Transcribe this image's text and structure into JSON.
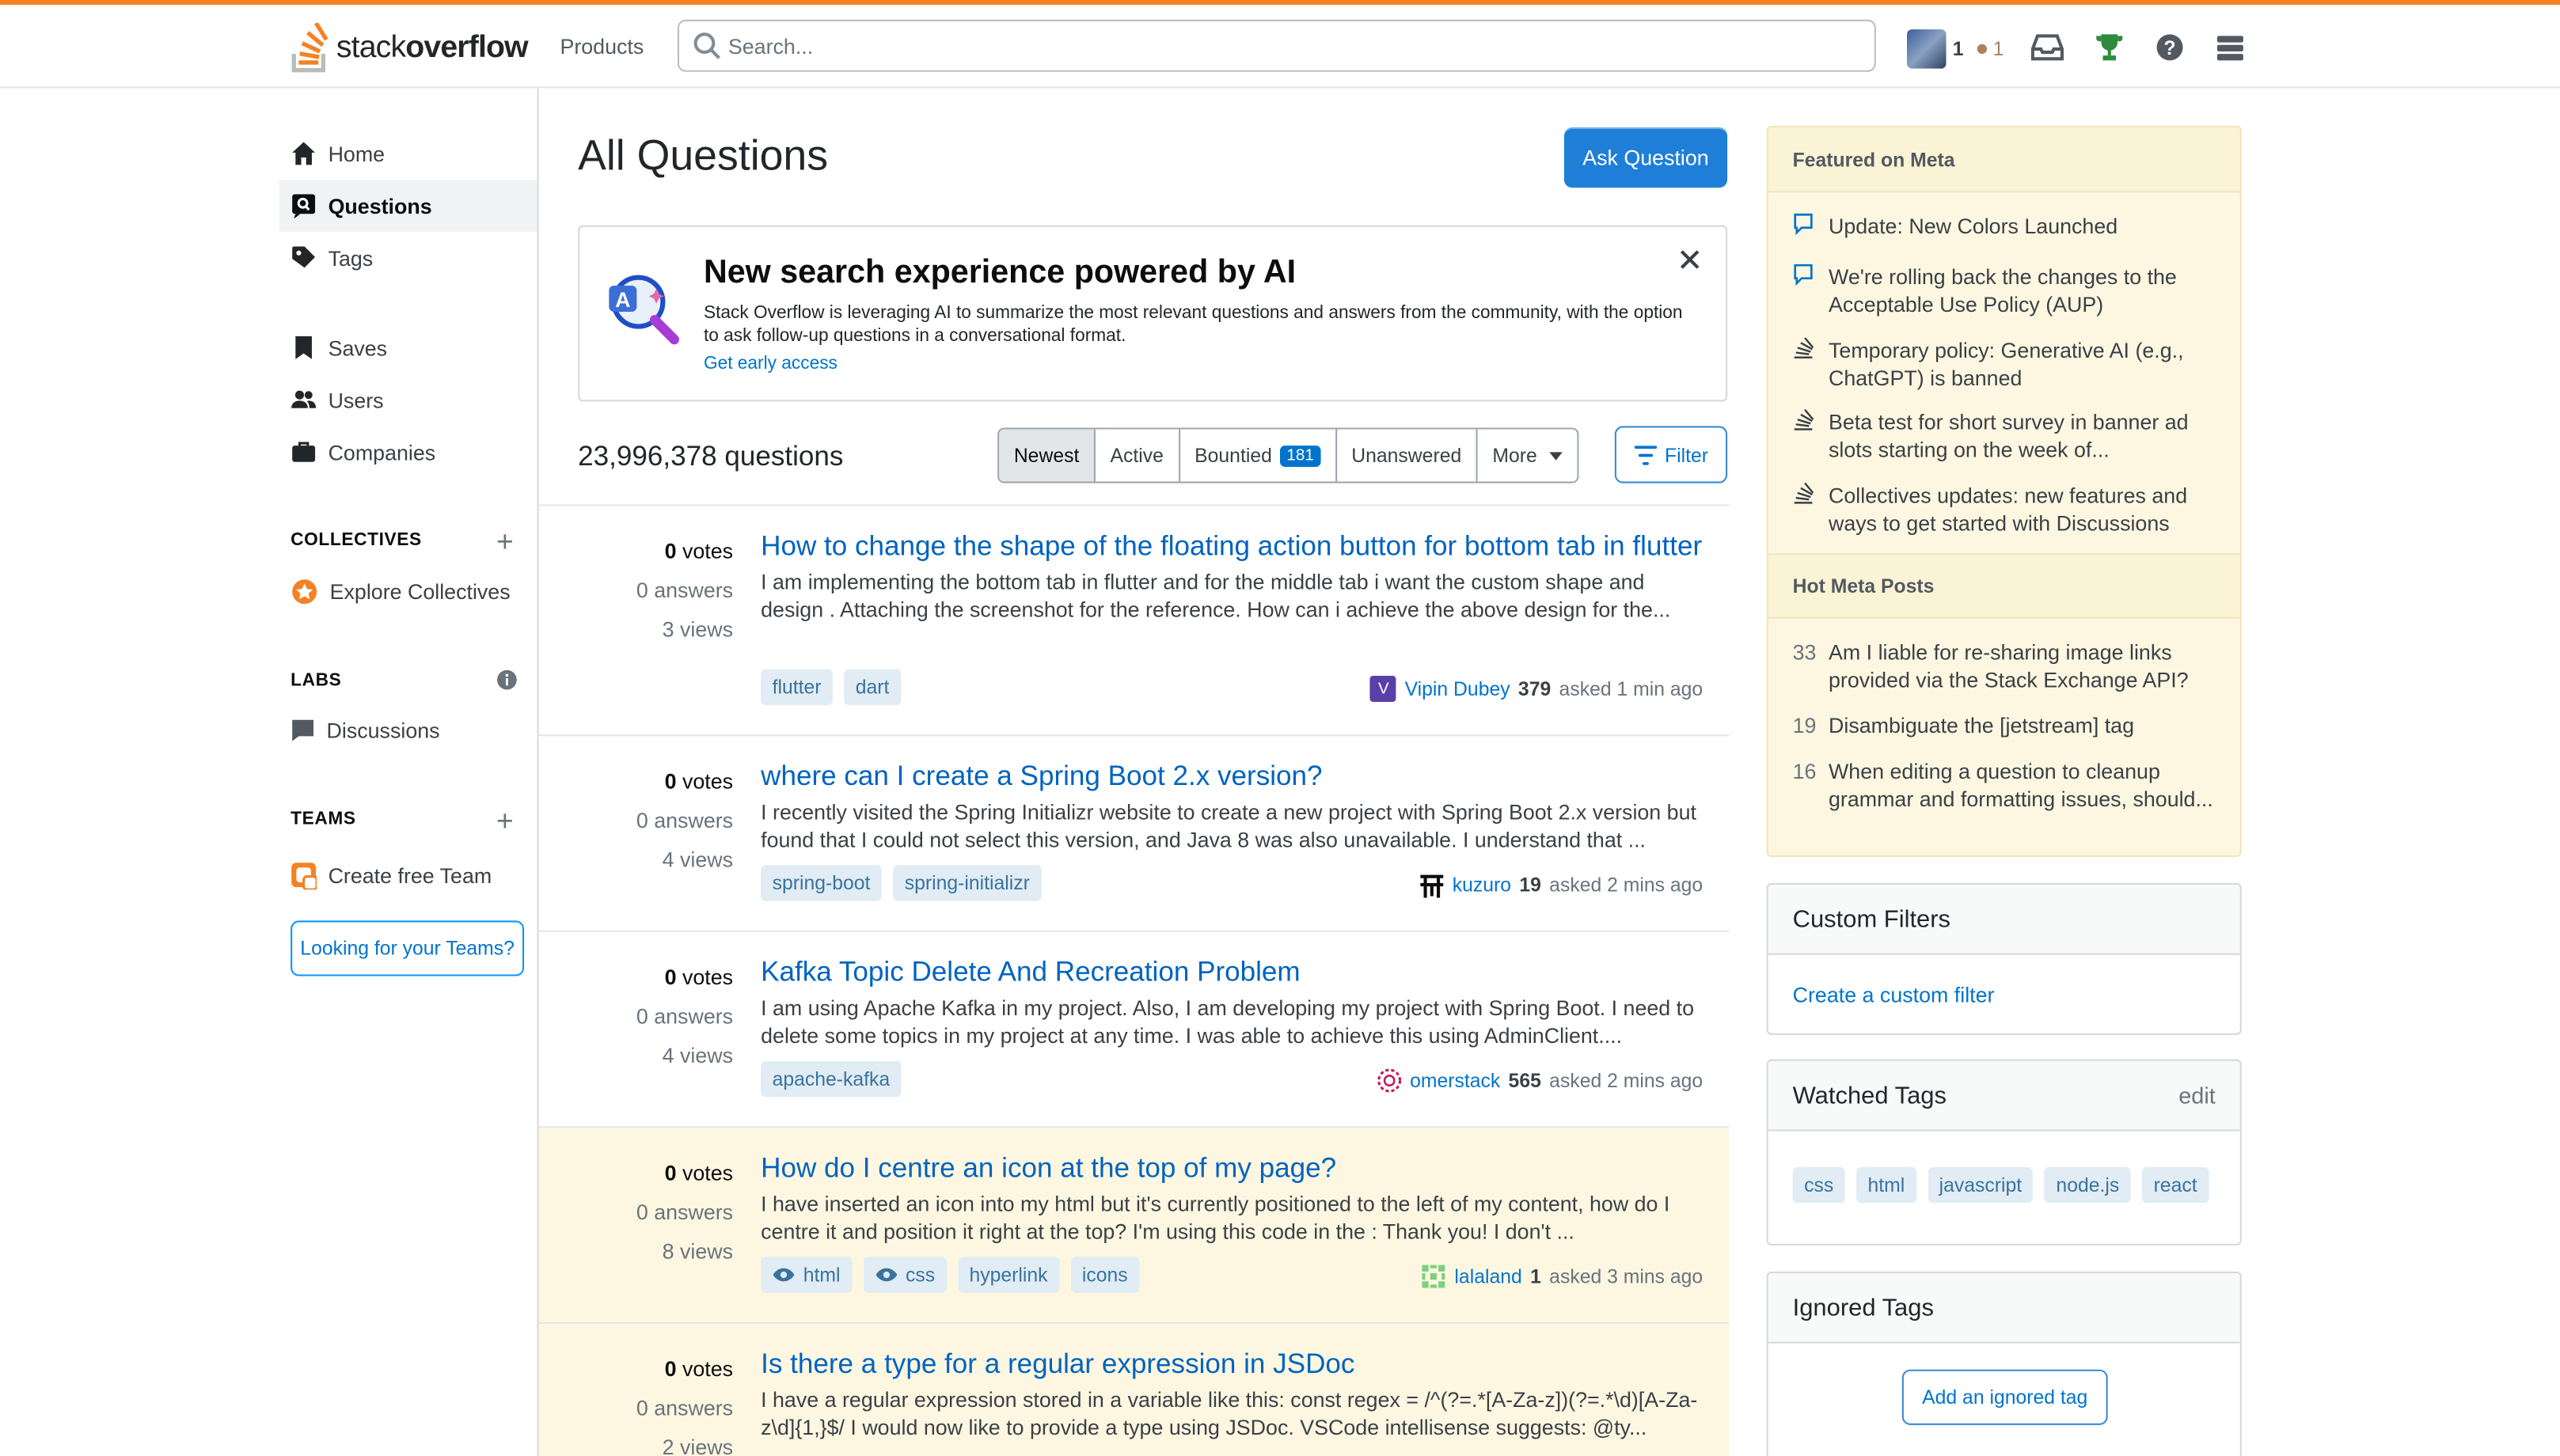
{
  "header": {
    "logo_light": "stack",
    "logo_bold": "overflow",
    "products": "Products",
    "search_placeholder": "Search...",
    "reputation": "1",
    "bronze_count": "1",
    "accent_color": "#f48225"
  },
  "leftnav": {
    "home": "Home",
    "questions": "Questions",
    "tags": "Tags",
    "saves": "Saves",
    "users": "Users",
    "companies": "Companies",
    "collectives_heading": "COLLECTIVES",
    "explore_collectives": "Explore Collectives",
    "labs_heading": "LABS",
    "discussions": "Discussions",
    "teams_heading": "TEAMS",
    "create_team": "Create free Team",
    "looking_teams": "Looking for your Teams?"
  },
  "main": {
    "title": "All Questions",
    "ask_button": "Ask Question",
    "ai_banner": {
      "title": "New search experience powered by AI",
      "description": "Stack Overflow is leveraging AI to summarize the most relevant questions and answers from the community, with the option to ask follow-up questions in a conversational format.",
      "link": "Get early access"
    },
    "question_count": "23,996,378 questions",
    "tabs": [
      {
        "label": "Newest"
      },
      {
        "label": "Active"
      },
      {
        "label": "Bountied",
        "badge": "181"
      },
      {
        "label": "Unanswered"
      },
      {
        "label": "More"
      }
    ],
    "filter_button": "Filter"
  },
  "questions": [
    {
      "votes": "0",
      "votes_label": "votes",
      "answers": "0 answers",
      "views": "3 views",
      "title": "How to change the shape of the floating action button for bottom tab in flutter",
      "excerpt": "I am implementing the bottom tab in flutter and for the middle tab i want the custom shape and design . Attaching the screenshot for the reference. How can i achieve the above design for the...",
      "tags": [
        "flutter",
        "dart"
      ],
      "user": "Vipin Dubey",
      "rep": "379",
      "asked": "asked 1 min ago",
      "avatar_color": "#5b3fa8",
      "avatar_letter": "V"
    },
    {
      "votes": "0",
      "votes_label": "votes",
      "answers": "0 answers",
      "views": "4 views",
      "title": "where can I create a Spring Boot 2.x version?",
      "excerpt": "I recently visited the Spring Initializr website to create a new project with Spring Boot 2.x version but found that I could not select this version, and Java 8 was also unavailable. I understand that ...",
      "tags": [
        "spring-boot",
        "spring-initializr"
      ],
      "user": "kuzuro",
      "rep": "19",
      "asked": "asked 2 mins ago",
      "avatar_color": "#0c0d0e",
      "avatar_letter": "▦"
    },
    {
      "votes": "0",
      "votes_label": "votes",
      "answers": "0 answers",
      "views": "4 views",
      "title": "Kafka Topic Delete And Recreation Problem",
      "excerpt": "I am using Apache Kafka in my project. Also, I am developing my project with Spring Boot. I need to delete some topics in my project at any time. I was able to achieve this using AdminClient....",
      "tags": [
        "apache-kafka"
      ],
      "user": "omerstack",
      "rep": "565",
      "asked": "asked 2 mins ago",
      "avatar_color": "#c2185b",
      "avatar_letter": ""
    },
    {
      "votes": "0",
      "votes_label": "votes",
      "answers": "0 answers",
      "views": "8 views",
      "title": "How do I centre an icon at the top of my page?",
      "excerpt": "I have inserted an icon into my html but it's currently positioned to the left of my content, how do I centre it and position it right at the top? I'm using this code in the : Thank you! I don't ...",
      "tags": [
        "html",
        "css",
        "hyperlink",
        "icons"
      ],
      "watched_tags": [
        "html",
        "css"
      ],
      "user": "lalaland",
      "rep": "1",
      "asked": "asked 3 mins ago",
      "avatar_color": "#7cd17c",
      "avatar_letter": ""
    },
    {
      "votes": "0",
      "votes_label": "votes",
      "answers": "0 answers",
      "views": "2 views",
      "title": "Is there a type for a regular expression in JSDoc",
      "excerpt": "I have a regular expression stored in a variable like this: const regex = /^(?=.*[A-Za-z])(?=.*\\d)[A-Za-z\\d]{1,}$/ I would now like to provide a type using JSDoc. VSCode intellisense suggests: @ty...",
      "tags": [],
      "user": "",
      "rep": "",
      "asked": ""
    }
  ],
  "sidebar": {
    "featured_heading": "Featured on Meta",
    "featured": [
      "Update: New Colors Launched",
      "We're rolling back the changes to the Acceptable Use Policy (AUP)",
      "Temporary policy: Generative AI (e.g., ChatGPT) is banned",
      "Beta test for short survey in banner ad slots starting on the week of...",
      "Collectives updates: new features and ways to get started with Discussions"
    ],
    "hot_heading": "Hot Meta Posts",
    "hot": [
      {
        "count": "33",
        "title": "Am I liable for re-sharing image links provided via the Stack Exchange API?"
      },
      {
        "count": "19",
        "title": "Disambiguate the [jetstream] tag"
      },
      {
        "count": "16",
        "title": "When editing a question to cleanup grammar and formatting issues, should..."
      }
    ],
    "custom_filters_heading": "Custom Filters",
    "create_filter": "Create a custom filter",
    "watched_heading": "Watched Tags",
    "watched_edit": "edit",
    "watched_tags": [
      "css",
      "html",
      "javascript",
      "node.js",
      "react"
    ],
    "ignored_heading": "Ignored Tags",
    "add_ignored": "Add an ignored tag"
  }
}
